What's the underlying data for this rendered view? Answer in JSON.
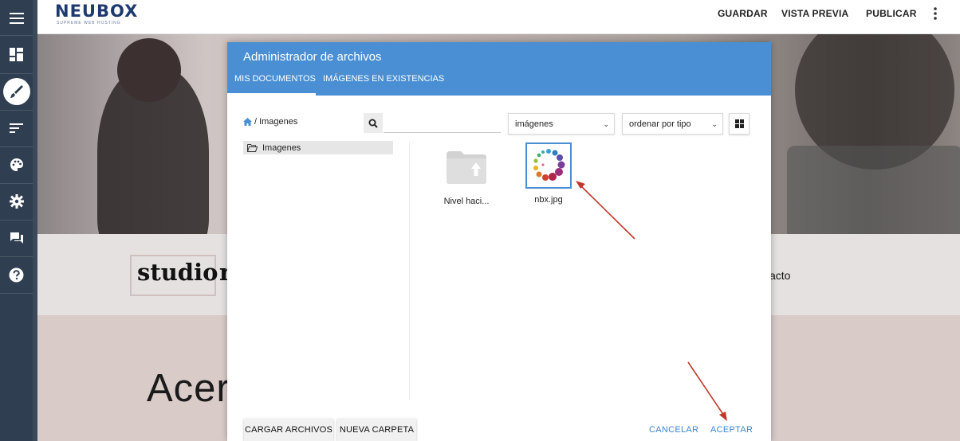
{
  "topbar": {
    "logo_text": "NEUBOX",
    "logo_tagline": "SUPREME WEB HOSTING",
    "save_label": "GUARDAR",
    "preview_label": "VISTA PREVIA",
    "publish_label": "PUBLICAR"
  },
  "sidebar": {
    "items": [
      {
        "icon": "menu-icon"
      },
      {
        "icon": "dashboard-icon"
      },
      {
        "icon": "brush-icon",
        "active": true
      },
      {
        "icon": "sort-icon"
      },
      {
        "icon": "palette-icon"
      },
      {
        "icon": "gear-icon"
      },
      {
        "icon": "chat-icon"
      },
      {
        "icon": "help-icon"
      }
    ]
  },
  "background_site": {
    "brand_word1": "studio",
    "brand_word2": "r",
    "nav_fragment": "acto",
    "heading_fragment": "Acer"
  },
  "dialog": {
    "title": "Administrador de archivos",
    "tabs": [
      {
        "label": "MIS DOCUMENTOS",
        "active": true
      },
      {
        "label": "IMÁGENES EN EXISTENCIAS",
        "active": false
      }
    ],
    "breadcrumb": {
      "separator": "/",
      "current": "Imagenes"
    },
    "search": {
      "value": "",
      "placeholder": ""
    },
    "filter_select": {
      "value": "imágenes"
    },
    "sort_select": {
      "value": "ordenar por tipo"
    },
    "tree": [
      {
        "label": "Imagenes",
        "selected": true
      }
    ],
    "files": [
      {
        "name": "Nivel haci...",
        "type": "folder-up",
        "icon": "folder-up-icon"
      },
      {
        "name": "nbx.jpg",
        "type": "image",
        "icon": "image-thumbnail",
        "selected": true
      }
    ],
    "footer": {
      "upload_label": "CARGAR ARCHIVOS",
      "new_folder_label": "NUEVA CARPETA",
      "cancel_label": "CANCELAR",
      "accept_label": "ACEPTAR"
    }
  },
  "colors": {
    "accent": "#4a8fd3",
    "rail": "#2f3e50",
    "annotation_arrow": "#c0392b"
  }
}
